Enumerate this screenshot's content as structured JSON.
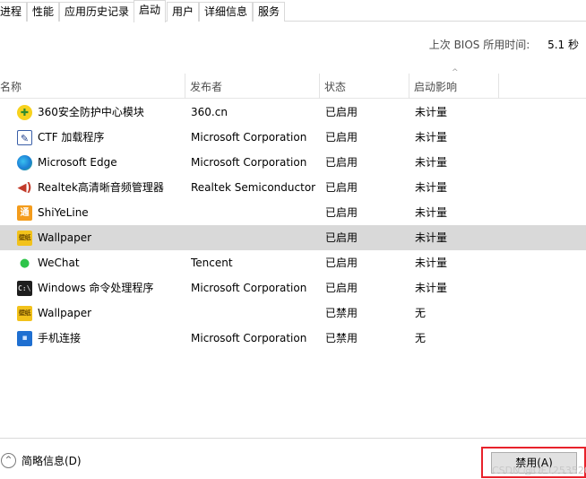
{
  "tabs": [
    {
      "label": "进程"
    },
    {
      "label": "性能"
    },
    {
      "label": "应用历史记录"
    },
    {
      "label": "启动",
      "active": true
    },
    {
      "label": "用户"
    },
    {
      "label": "详细信息"
    },
    {
      "label": "服务"
    }
  ],
  "bios": {
    "label": "上次 BIOS 所用时间:",
    "value": "5.1 秒"
  },
  "columns": {
    "name": "名称",
    "publisher": "发布者",
    "status": "状态",
    "impact": "启动影响"
  },
  "sort_indicator": "^",
  "rows": [
    {
      "name": "360安全防护中心模块",
      "publisher": "360.cn",
      "status": "已启用",
      "impact": "未计量",
      "icon": "shield-360-icon",
      "glyph": "✚"
    },
    {
      "name": "CTF 加载程序",
      "publisher": "Microsoft Corporation",
      "status": "已启用",
      "impact": "未计量",
      "icon": "ctf-pen-icon",
      "glyph": "✎"
    },
    {
      "name": "Microsoft Edge",
      "publisher": "Microsoft Corporation",
      "status": "已启用",
      "impact": "未计量",
      "icon": "edge-icon",
      "glyph": ""
    },
    {
      "name": "Realtek高清晰音频管理器",
      "publisher": "Realtek Semiconductor",
      "status": "已启用",
      "impact": "未计量",
      "icon": "speaker-icon",
      "glyph": "◀)"
    },
    {
      "name": "ShiYeLine",
      "publisher": "",
      "status": "已启用",
      "impact": "未计量",
      "icon": "shiyeline-icon",
      "glyph": "通"
    },
    {
      "name": "Wallpaper",
      "publisher": "",
      "status": "已启用",
      "impact": "未计量",
      "icon": "wallpaper-icon",
      "glyph": "壁纸",
      "selected": true
    },
    {
      "name": "WeChat",
      "publisher": "Tencent",
      "status": "已启用",
      "impact": "未计量",
      "icon": "wechat-icon",
      "glyph": "●"
    },
    {
      "name": "Windows 命令处理程序",
      "publisher": "Microsoft Corporation",
      "status": "已启用",
      "impact": "未计量",
      "icon": "cmd-icon",
      "glyph": "C:\\"
    },
    {
      "name": "Wallpaper",
      "publisher": "",
      "status": "已禁用",
      "impact": "无",
      "icon": "wallpaper-icon",
      "glyph": "壁纸"
    },
    {
      "name": "手机连接",
      "publisher": "Microsoft Corporation",
      "status": "已禁用",
      "impact": "无",
      "icon": "phone-link-icon",
      "glyph": "▪"
    }
  ],
  "footer": {
    "less_details_label": "简略信息(D)",
    "chevron_glyph": "^",
    "disable_label": "禁用(A)",
    "watermark": "CSDN @OF1253520"
  },
  "colors": {
    "selected_row": "#d9d9d9",
    "highlight_box": "#e8222b"
  }
}
